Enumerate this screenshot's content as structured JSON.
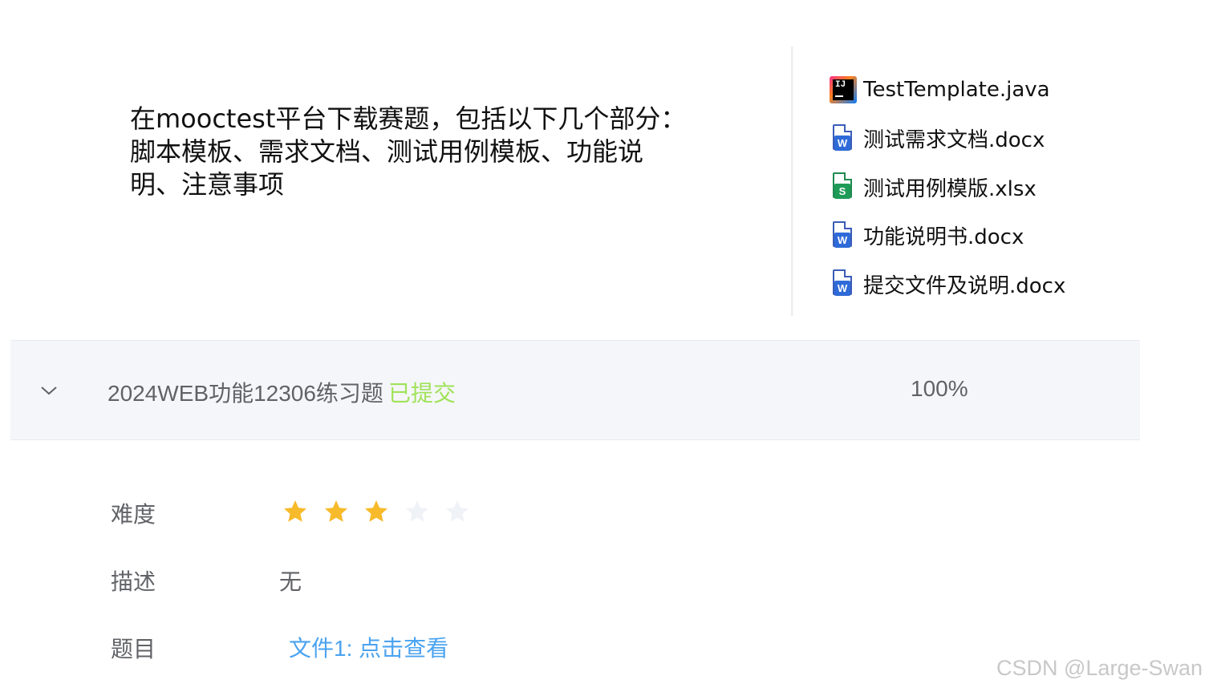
{
  "intro": {
    "text": "在mooctest平台下载赛题，包括以下几个部分：脚本模板、需求文档、测试用例模板、功能说明、注意事项"
  },
  "files": [
    {
      "name": "TestTemplate.java",
      "icon": "intellij-java-icon"
    },
    {
      "name": "测试需求文档.docx",
      "icon": "word-document-icon"
    },
    {
      "name": "测试用例模版.xlsx",
      "icon": "spreadsheet-icon"
    },
    {
      "name": "功能说明书.docx",
      "icon": "word-document-icon"
    },
    {
      "name": "提交文件及说明.docx",
      "icon": "word-document-icon"
    }
  ],
  "task": {
    "title": "2024WEB功能12306练习题",
    "status": "已提交",
    "status_color": "#a0e25a",
    "progress": "100%",
    "expand_icon": "chevron-down-icon"
  },
  "details": {
    "difficulty_label": "难度",
    "difficulty_rating": 3,
    "difficulty_max": 5,
    "description_label": "描述",
    "description_value": "无",
    "problem_label": "题目",
    "problem_link": "文件1: 点击查看"
  },
  "colors": {
    "star_filled": "#f7ba2a",
    "star_empty": "#eff2f7",
    "link": "#4aa3f0",
    "row_bg": "#f5f6fa"
  },
  "watermark": "CSDN @Large-Swan"
}
